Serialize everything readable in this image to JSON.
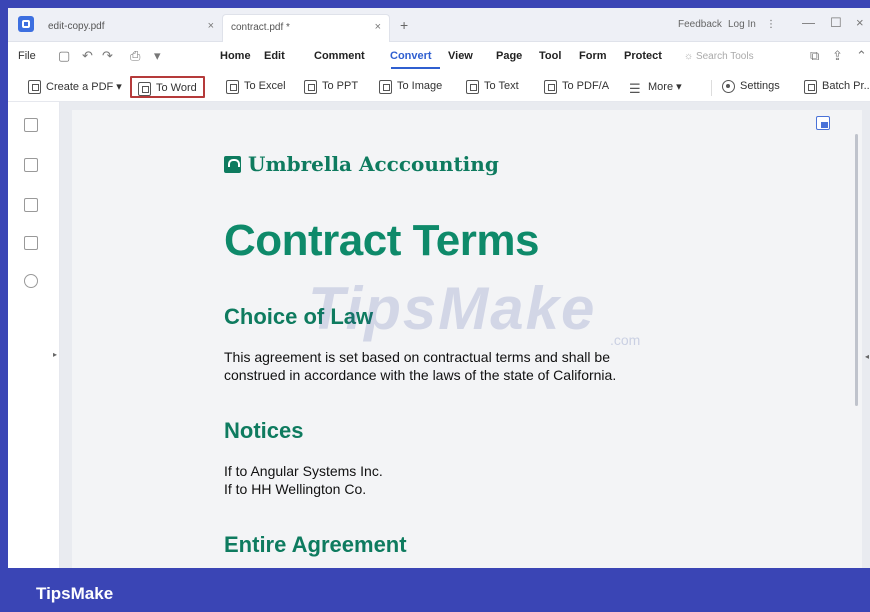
{
  "titlebar": {
    "tabs": [
      {
        "label": "edit-copy.pdf"
      },
      {
        "label": "contract.pdf *"
      }
    ],
    "close_glyph": "×",
    "new_tab_glyph": "+",
    "feedback": "Feedback",
    "login": "Log In",
    "more_glyph": "⋮",
    "minimize_glyph": "—",
    "maximize_glyph": "☐",
    "close_window_glyph": "×"
  },
  "menubar": {
    "file": "File",
    "items": [
      {
        "label": "Home"
      },
      {
        "label": "Edit"
      },
      {
        "label": "Comment"
      },
      {
        "label": "Convert"
      },
      {
        "label": "View"
      },
      {
        "label": "Page"
      },
      {
        "label": "Tool"
      },
      {
        "label": "Form"
      },
      {
        "label": "Protect"
      }
    ],
    "active": "Convert",
    "search_placeholder": "Search Tools"
  },
  "toolbar": {
    "create_pdf": "Create a PDF",
    "to_word": "To Word",
    "to_excel": "To Excel",
    "to_ppt": "To PPT",
    "to_image": "To Image",
    "to_text": "To Text",
    "to_pdfa": "To PDF/A",
    "more": "More",
    "settings": "Settings",
    "batch": "Batch Pr..."
  },
  "document": {
    "brand": "Umbrella Acccounting",
    "title": "Contract Terms",
    "sections": [
      {
        "heading": "Choice of Law",
        "lines": [
          "This agreement is set based on contractual terms and shall be",
          "construed in accordance with the laws of the state of California."
        ]
      },
      {
        "heading": "Notices",
        "lines": [
          "If to Angular Systems Inc.",
          "If to HH Wellington Co."
        ]
      },
      {
        "heading": "Entire Agreement",
        "lines": []
      }
    ],
    "watermark": "TipsMake",
    "watermark_suffix": ".com"
  },
  "banner": {
    "text": "TipsMake"
  },
  "colors": {
    "brand_green": "#0e7b5f",
    "accent_blue": "#2f5fd0",
    "highlight_red": "#b53a3a",
    "banner_blue": "#3a45b5"
  }
}
